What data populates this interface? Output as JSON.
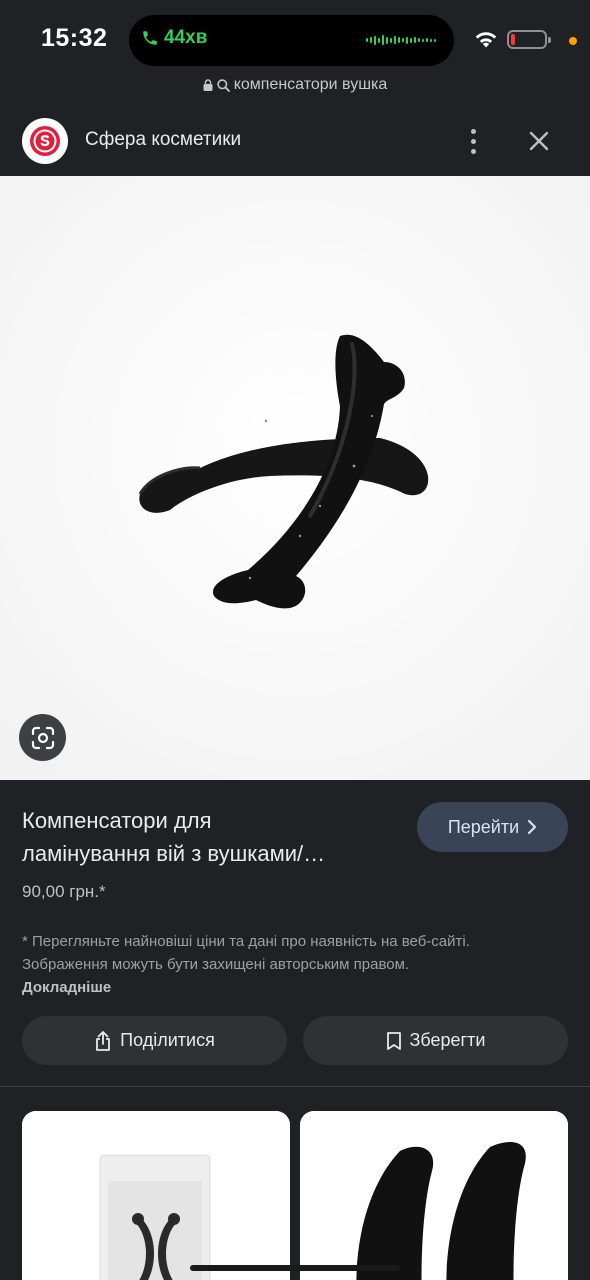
{
  "status_bar": {
    "time": "15:32",
    "call_duration": "44хв",
    "colors": {
      "call": "#30d158",
      "battery_low": "#ff3b30",
      "privacy_dot": "#ff9f0a"
    },
    "icons": [
      "phone-icon",
      "wifi-icon",
      "battery-icon"
    ]
  },
  "url_bar": {
    "query": "компенсатори вушка",
    "icons": [
      "lock-icon",
      "search-icon"
    ]
  },
  "header": {
    "site_name": "Сфера косметики",
    "icons": [
      "site-logo",
      "more-vert-icon",
      "close-icon"
    ]
  },
  "product": {
    "title_line1": "Компенсатори для",
    "title_line2": "ламінування вій з вушками/…",
    "visit_label": "Перейти",
    "price": "90,00 грн.*",
    "disclaimer": "* Перегляньте найновіші ціни та дані про наявність на веб-сайті. Зображення можуть бути захищені авторським правом.",
    "more_link": "Докладніше"
  },
  "actions": {
    "share_label": "Поділитися",
    "save_label": "Зберегти"
  }
}
